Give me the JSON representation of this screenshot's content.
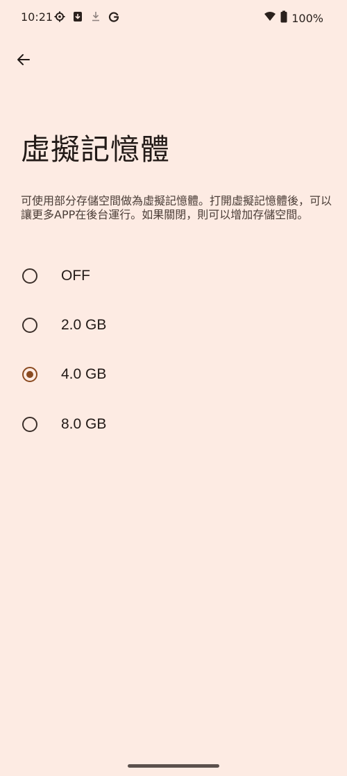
{
  "status_bar": {
    "time": "10:21",
    "left_icons": [
      "settings-icon",
      "download-box-icon",
      "download-arrow-icon",
      "google-icon"
    ],
    "right_icons": [
      "wifi-icon",
      "battery-icon"
    ],
    "battery": "100%"
  },
  "page": {
    "title": "虛擬記憶體",
    "description": "可使用部分存儲空間做為虛擬記憶體。打開虛擬記憶體後，可以讓更多APP在後台運行。如果關閉，則可以增加存儲空間。"
  },
  "options": [
    {
      "label": "OFF",
      "selected": false
    },
    {
      "label": "2.0 GB",
      "selected": false
    },
    {
      "label": "4.0 GB",
      "selected": true
    },
    {
      "label": "8.0 GB",
      "selected": false
    }
  ],
  "colors": {
    "background": "#fdebe3",
    "accent": "#8a4a20",
    "text": "#221a17"
  }
}
